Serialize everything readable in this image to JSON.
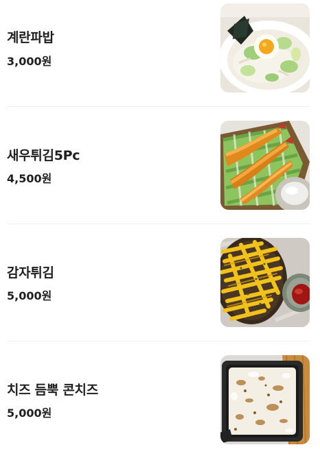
{
  "menu": {
    "items": [
      {
        "name": "계란파밥",
        "price": "3,000원",
        "photo": "egg-scallion-rice-photo"
      },
      {
        "name": "새우튀김5Pc",
        "price": "4,500원",
        "photo": "fried-shrimp-photo"
      },
      {
        "name": "감자튀김",
        "price": "5,000원",
        "photo": "french-fries-photo"
      },
      {
        "name": "치즈 듬뿍 콘치즈",
        "price": "5,000원",
        "photo": "corn-cheese-photo"
      }
    ]
  }
}
